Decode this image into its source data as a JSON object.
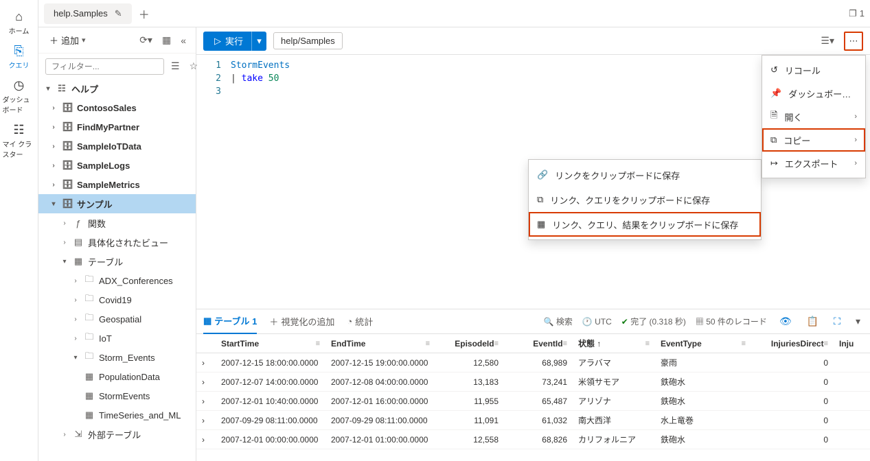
{
  "leftnav": {
    "items": [
      {
        "icon": "⌂",
        "label": "ホーム"
      },
      {
        "icon": "⎘",
        "label": "クエリ"
      },
      {
        "icon": "◷",
        "label": "ダッシュボード"
      },
      {
        "icon": "☷",
        "label": "マイ クラスター"
      }
    ]
  },
  "tabs": {
    "active": "help.Samples",
    "count": "1"
  },
  "sidebar": {
    "add_label": "追加",
    "filter_placeholder": "フィルター...",
    "root": "ヘルプ",
    "dbs": [
      "ContosoSales",
      "FindMyPartner",
      "SampleIoTData",
      "SampleLogs",
      "SampleMetrics"
    ],
    "selected_db": "サンプル",
    "folders": {
      "functions": "関数",
      "matviews": "具体化されたビュー",
      "tables": "テーブル",
      "ext_tables": "外部テーブル"
    },
    "table_folders": [
      "ADX_Conferences",
      "Covid19",
      "Geospatial",
      "IoT",
      "Storm_Events"
    ],
    "tables": [
      "PopulationData",
      "StormEvents",
      "TimeSeries_and_ML"
    ]
  },
  "query": {
    "run_label": "実行",
    "scope": "help/Samples",
    "lines": {
      "1": "1",
      "2": "2",
      "3": "3"
    },
    "code": {
      "ident": "StormEvents",
      "line2_pipe": "| ",
      "line2_kw": "take",
      "line2_num": " 50"
    }
  },
  "dropdown": {
    "recall": "リコール",
    "dashboard": "ダッシュボー…",
    "open": "開く",
    "copy": "コピー",
    "export": "エクスポート"
  },
  "submenu": {
    "link": "リンクをクリップボードに保存",
    "link_query": "リンク、クエリをクリップボードに保存",
    "link_query_results": "リンク、クエリ、結果をクリップボードに保存"
  },
  "results": {
    "tabs": {
      "table": "テーブル 1",
      "addviz": "視覚化の追加",
      "stats": "統計"
    },
    "search": "検索",
    "tz": "UTC",
    "status": "完了 (0.318 秒)",
    "records": "50 件のレコード",
    "columns": [
      "StartTime",
      "EndTime",
      "EpisodeId",
      "EventId",
      "状態",
      "EventType",
      "InjuriesDirect",
      "Inju"
    ],
    "rows": [
      {
        "start": "2007-12-15 18:00:00.0000",
        "end": "2007-12-15 19:00:00.0000",
        "ep": "12,580",
        "ev": "68,989",
        "state": "アラバマ",
        "type": "豪雨",
        "inj": "0"
      },
      {
        "start": "2007-12-07 14:00:00.0000",
        "end": "2007-12-08 04:00:00.0000",
        "ep": "13,183",
        "ev": "73,241",
        "state": "米領サモア",
        "type": "鉄砲水",
        "inj": "0"
      },
      {
        "start": "2007-12-01 10:40:00.0000",
        "end": "2007-12-01 16:00:00.0000",
        "ep": "11,955",
        "ev": "65,487",
        "state": "アリゾナ",
        "type": "鉄砲水",
        "inj": "0"
      },
      {
        "start": "2007-09-29 08:11:00.0000",
        "end": "2007-09-29 08:11:00.0000",
        "ep": "11,091",
        "ev": "61,032",
        "state": "南大西洋",
        "type": "水上竜巻",
        "inj": "0"
      },
      {
        "start": "2007-12-01 00:00:00.0000",
        "end": "2007-12-01 01:00:00.0000",
        "ep": "12,558",
        "ev": "68,826",
        "state": "カリフォルニア",
        "type": "鉄砲水",
        "inj": "0"
      }
    ]
  }
}
